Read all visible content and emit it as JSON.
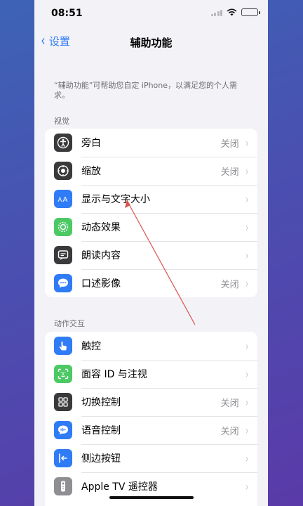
{
  "status_bar": {
    "time": "08:51"
  },
  "nav": {
    "back_label": "设置",
    "title": "辅助功能"
  },
  "intro_text": "“辅助功能”可帮助您自定 iPhone，以满足您的个人需求。",
  "sections": [
    {
      "header": "视觉",
      "items": [
        {
          "label": "旁白",
          "value": "关闭",
          "icon": "voiceover-icon",
          "color": "#3a3a3c"
        },
        {
          "label": "缩放",
          "value": "关闭",
          "icon": "zoom-icon",
          "color": "#3a3a3c"
        },
        {
          "label": "显示与文字大小",
          "value": "",
          "icon": "text-size-icon",
          "color": "#2f7cf6"
        },
        {
          "label": "动态效果",
          "value": "",
          "icon": "motion-icon",
          "color": "#4cc964"
        },
        {
          "label": "朗读内容",
          "value": "",
          "icon": "spoken-content-icon",
          "color": "#3a3a3c"
        },
        {
          "label": "口述影像",
          "value": "关闭",
          "icon": "audio-description-icon",
          "color": "#2f7cf6"
        }
      ]
    },
    {
      "header": "动作交互",
      "items": [
        {
          "label": "触控",
          "value": "",
          "icon": "touch-icon",
          "color": "#2f7cf6"
        },
        {
          "label": "面容 ID 与注视",
          "value": "",
          "icon": "face-id-icon",
          "color": "#4cc964"
        },
        {
          "label": "切换控制",
          "value": "关闭",
          "icon": "switch-control-icon",
          "color": "#3a3a3c"
        },
        {
          "label": "语音控制",
          "value": "关闭",
          "icon": "voice-control-icon",
          "color": "#2f7cf6"
        },
        {
          "label": "侧边按钮",
          "value": "",
          "icon": "side-button-icon",
          "color": "#2f7cf6"
        },
        {
          "label": "Apple TV 遥控器",
          "value": "",
          "icon": "apple-tv-remote-icon",
          "color": "#8e8e93"
        }
      ]
    }
  ],
  "annotation_color": "#d9534f"
}
